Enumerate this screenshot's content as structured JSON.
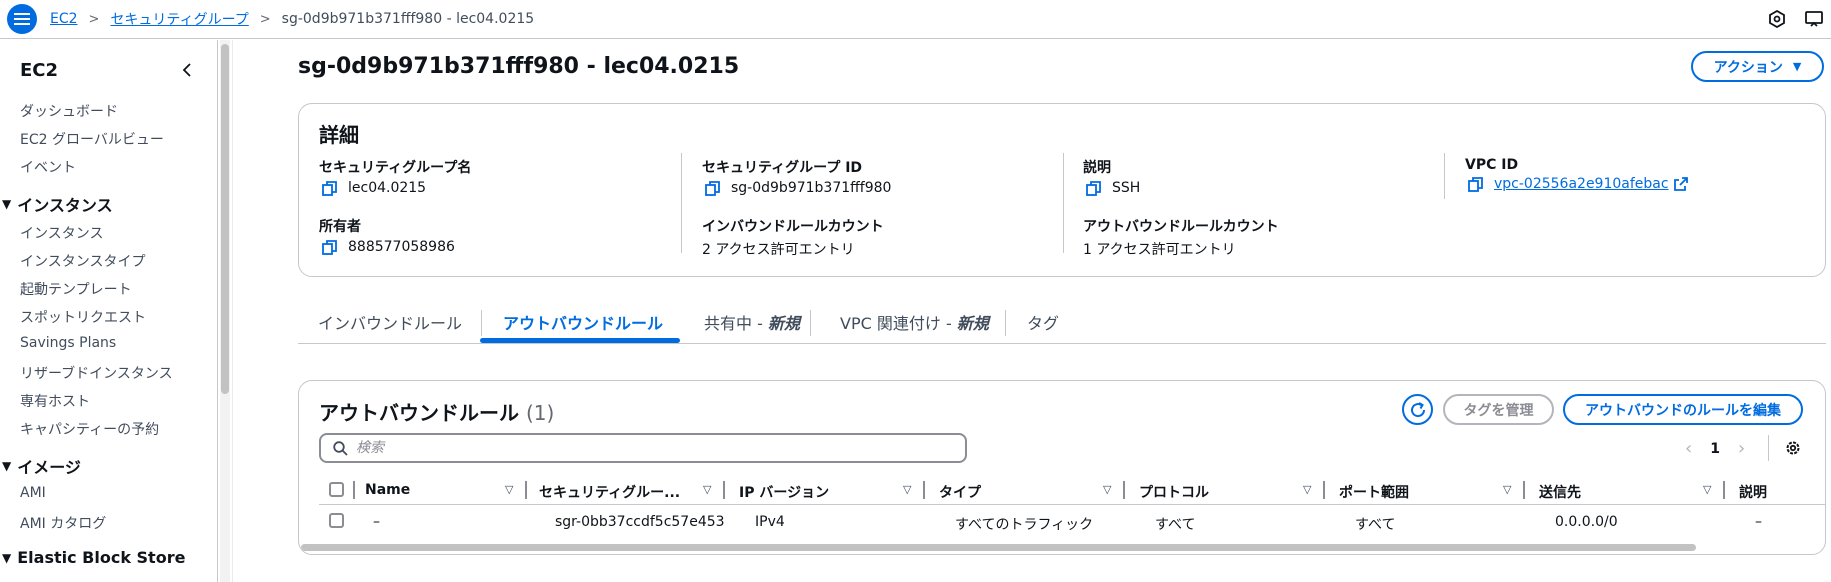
{
  "breadcrumb": {
    "home": "EC2",
    "section": "セキュリティグループ",
    "current": "sg-0d9b971b371fff980 - lec04.0215"
  },
  "sidebar": {
    "title": "EC2",
    "top_items": [
      "ダッシュボード",
      "EC2 グローバルビュー",
      "イベント"
    ],
    "groups": [
      {
        "label": "インスタンス",
        "items": [
          "インスタンス",
          "インスタンスタイプ",
          "起動テンプレート",
          "スポットリクエスト",
          "Savings Plans",
          "リザーブドインスタンス",
          "専有ホスト",
          "キャパシティーの予約"
        ]
      },
      {
        "label": "イメージ",
        "items": [
          "AMI",
          "AMI カタログ"
        ]
      },
      {
        "label": "Elastic Block Store",
        "items": []
      }
    ]
  },
  "page": {
    "title": "sg-0d9b971b371fff980 - lec04.0215",
    "action_label": "アクション"
  },
  "details": {
    "heading": "詳細",
    "sg_name": {
      "label": "セキュリティグループ名",
      "value": "lec04.0215"
    },
    "sg_id": {
      "label": "セキュリティグループ ID",
      "value": "sg-0d9b971b371fff980"
    },
    "description": {
      "label": "説明",
      "value": "SSH"
    },
    "vpc_id": {
      "label": "VPC ID",
      "value": "vpc-02556a2e910afebac"
    },
    "owner": {
      "label": "所有者",
      "value": "888577058986"
    },
    "inbound_count": {
      "label": "インバウンドルールカウント",
      "value": "2 アクセス許可エントリ"
    },
    "outbound_count": {
      "label": "アウトバウンドルールカウント",
      "value": "1 アクセス許可エントリ"
    }
  },
  "tabs": {
    "inbound": "インバウンドルール",
    "outbound": "アウトバウンドルール",
    "sharing": "共有中 - ",
    "sharing_new": "新規",
    "vpc_assoc": "VPC 関連付け - ",
    "vpc_new": "新規",
    "tags": "タグ"
  },
  "rules": {
    "heading": "アウトバウンドルール",
    "count": "(1)",
    "manage_tags": "タグを管理",
    "edit_rules": "アウトバウンドのルールを編集",
    "search_placeholder": "検索",
    "page": "1",
    "columns": [
      "Name",
      "セキュリティグルー...",
      "IP バージョン",
      "タイプ",
      "プロトコル",
      "ポート範囲",
      "送信先",
      "説明"
    ],
    "rows": [
      {
        "name": "–",
        "rule_id": "sgr-0bb37ccdf5c57e453",
        "ip_version": "IPv4",
        "type": "すべてのトラフィック",
        "protocol": "すべて",
        "port_range": "すべて",
        "destination": "0.0.0.0/0",
        "description": "–"
      }
    ]
  },
  "colors": {
    "accent": "#006ce0",
    "border": "#c6c6cd",
    "text": "#0f141a"
  }
}
